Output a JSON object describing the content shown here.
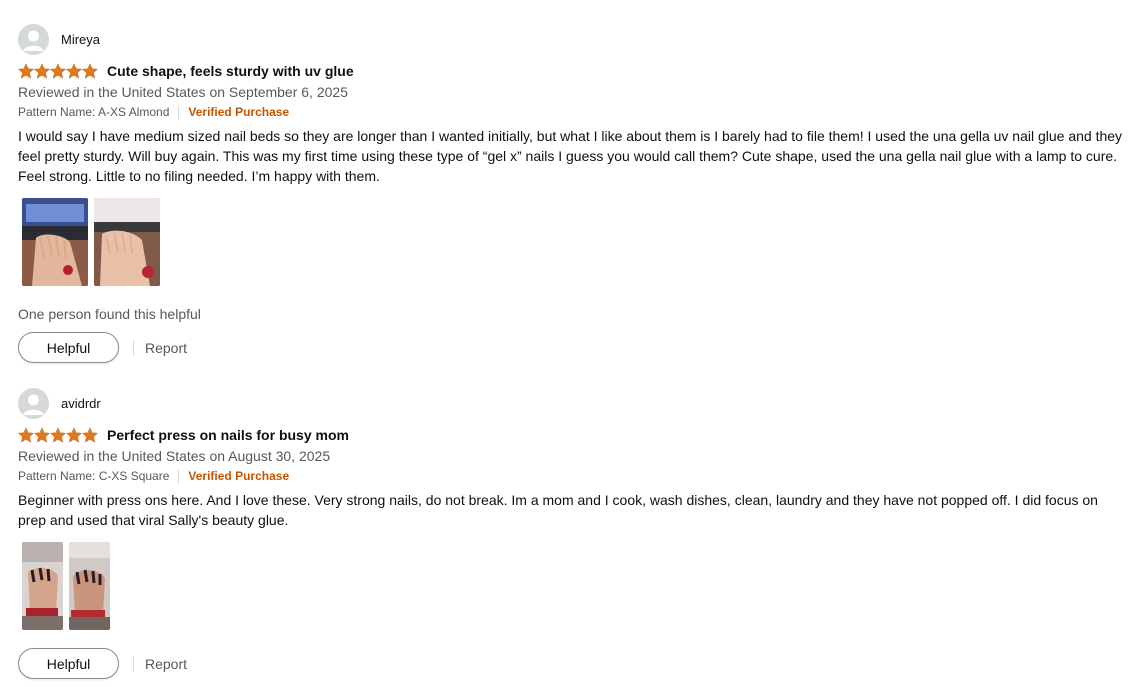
{
  "reviews": [
    {
      "reviewer": "Mireya",
      "rating": 5,
      "title": "Cute shape, feels sturdy with uv glue",
      "date": "Reviewed in the United States on September 6, 2025",
      "pattern": "Pattern Name: A-XS Almond",
      "verified": "Verified Purchase",
      "body": "I would say I have medium sized nail beds so they are longer than I wanted initially, but what I like about them is I barely had to file them! I used the una gella uv nail glue and they feel pretty sturdy. Will buy again. This was my first time using these type of “gel x” nails I guess you would call them? Cute shape, used the una gella nail glue with a lamp to cure. Feel strong. Little to no filing needed. I’m happy with them.",
      "helpful_count": "One person found this helpful",
      "helpful_label": "Helpful",
      "report_label": "Report"
    },
    {
      "reviewer": "avidrdr",
      "rating": 5,
      "title": "Perfect press on nails for busy mom",
      "date": "Reviewed in the United States on August 30, 2025",
      "pattern": "Pattern Name: C-XS Square",
      "verified": "Verified Purchase",
      "body": "Beginner with press ons here. And I love these. Very strong nails, do not break. Im a mom and I cook, wash dishes, clean, laundry and they have not popped off. I did focus on prep and used that viral Sally's beauty glue.",
      "helpful_label": "Helpful",
      "report_label": "Report"
    }
  ],
  "colors": {
    "star": "#de7921",
    "verified": "#c45500",
    "muted": "#565959"
  }
}
